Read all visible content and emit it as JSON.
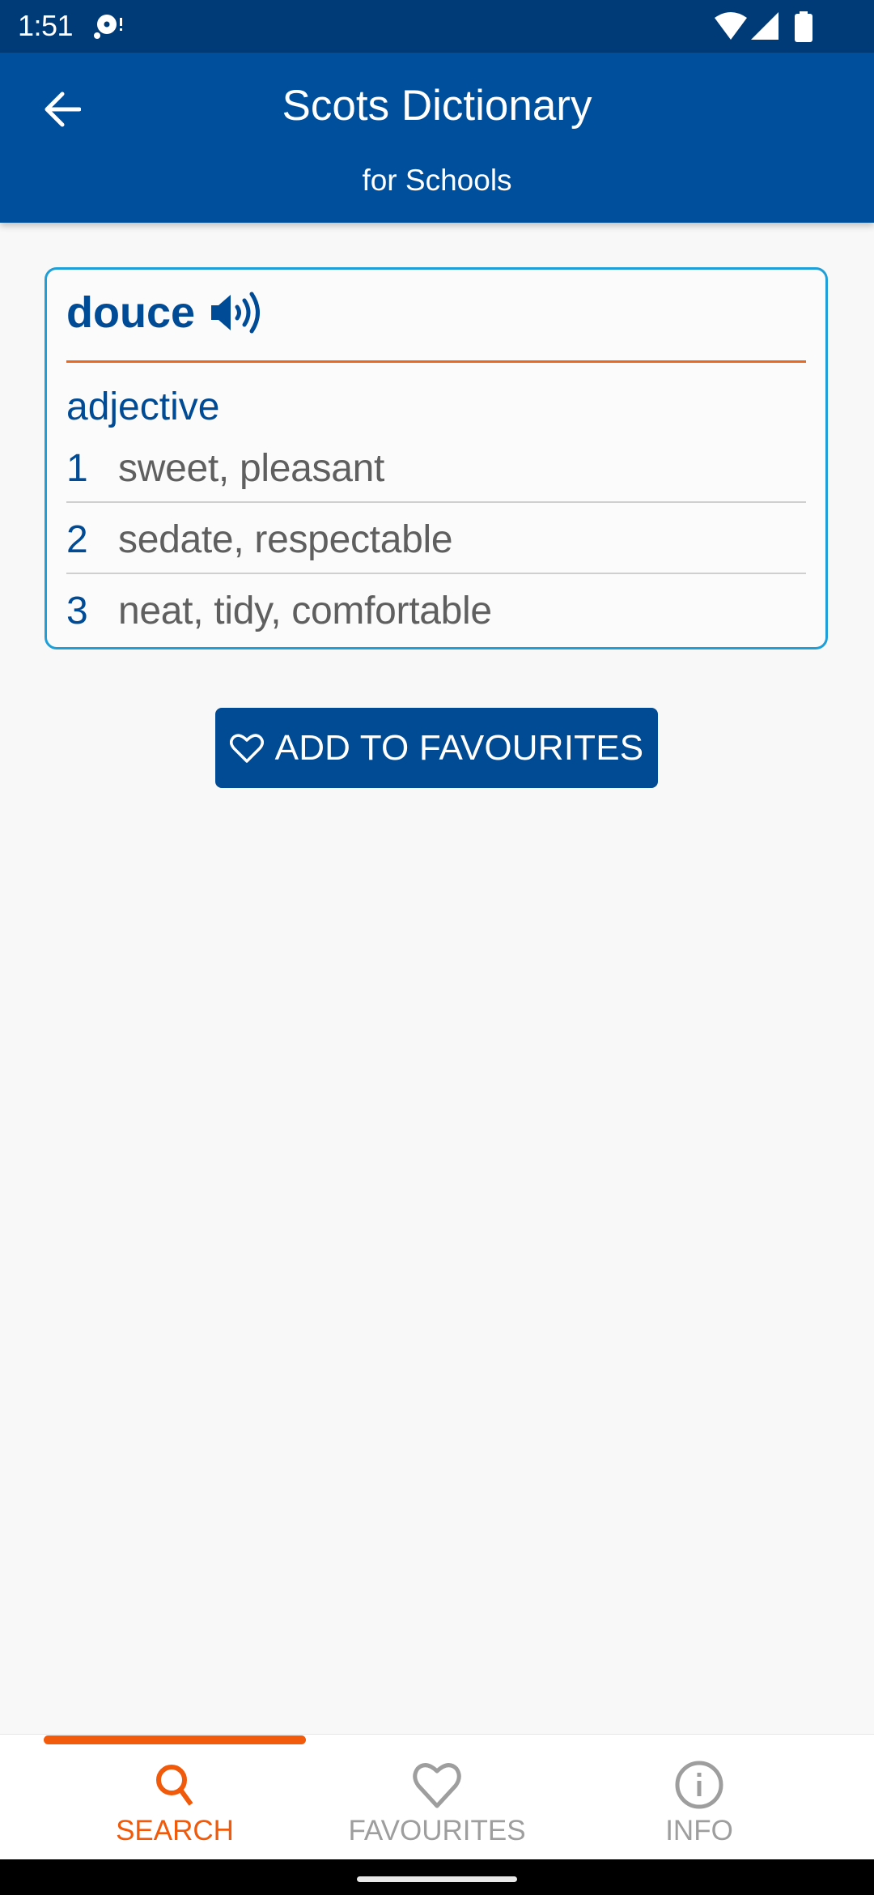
{
  "status_bar": {
    "time": "1:51",
    "icons": [
      "notification-icon",
      "wifi-icon",
      "cell-signal-icon",
      "battery-icon"
    ]
  },
  "app_bar": {
    "back_icon": "arrow-left-icon",
    "title": "Scots Dictionary",
    "subtitle": "for Schools"
  },
  "entry": {
    "headword": "douce",
    "audio_icon": "speaker-icon",
    "part_of_speech": "adjective",
    "senses": [
      {
        "number": "1",
        "text": "sweet, pleasant"
      },
      {
        "number": "2",
        "text": "sedate, respectable"
      },
      {
        "number": "3",
        "text": "neat, tidy, comfortable"
      }
    ]
  },
  "actions": {
    "add_favourite_icon": "heart-outline-icon",
    "add_favourite_label": "ADD TO FAVOURITES"
  },
  "bottom_nav": {
    "active_index": 0,
    "tabs": [
      {
        "label": "SEARCH",
        "icon": "search-icon",
        "active": true
      },
      {
        "label": "FAVOURITES",
        "icon": "heart-outline-icon",
        "active": false
      },
      {
        "label": "INFO",
        "icon": "info-icon",
        "active": false
      }
    ]
  },
  "colors": {
    "status_bar": "#003b78",
    "app_bar": "#004f9c",
    "primary_blue": "#004b96",
    "card_border": "#1e9fd7",
    "accent_orange": "#f05a0a",
    "rule_orange": "#e8681f",
    "definition_gray": "#5f5f5f",
    "inactive_gray": "#9e9e9e",
    "background": "#f8f8f8"
  }
}
